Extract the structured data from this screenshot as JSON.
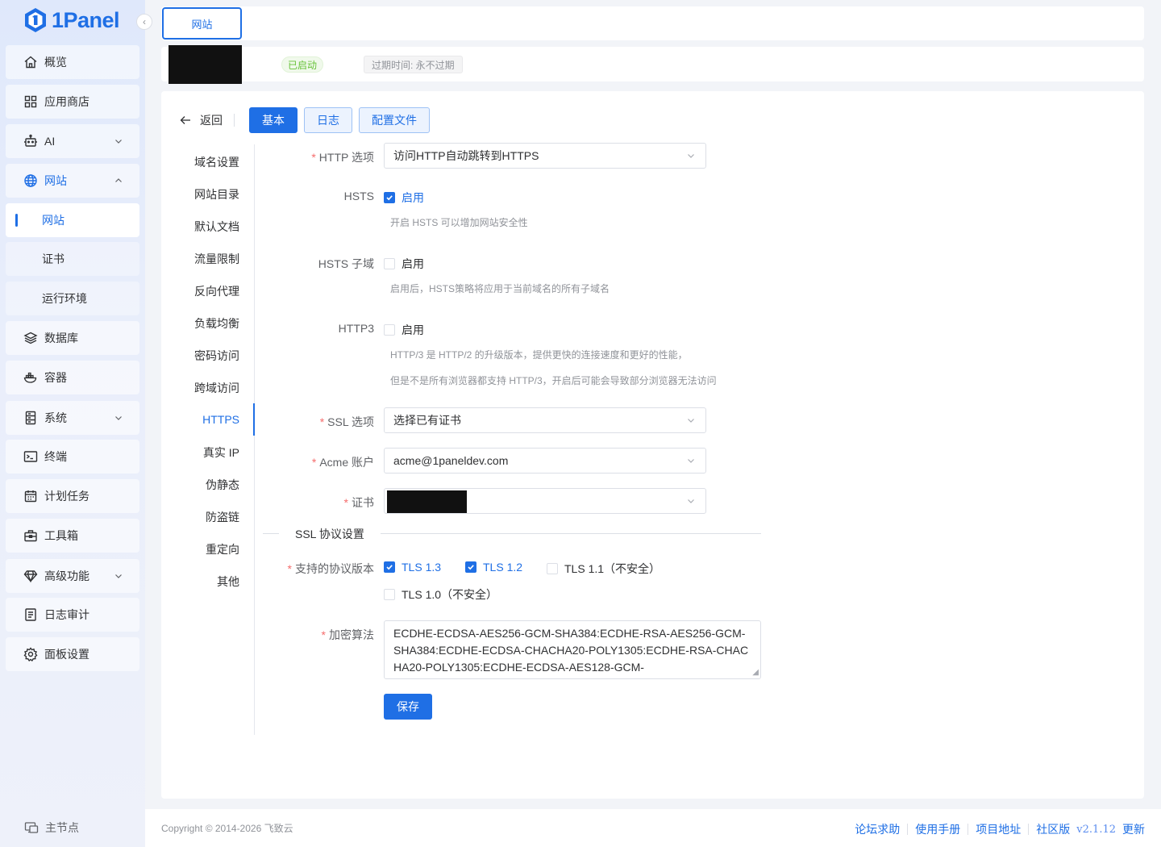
{
  "app": {
    "logo_text": "1Panel",
    "collapse_icon": "chevron-left-icon"
  },
  "sidebar": {
    "items": [
      {
        "label": "概览",
        "icon": "home-icon"
      },
      {
        "label": "应用商店",
        "icon": "grid-icon"
      },
      {
        "label": "AI",
        "icon": "robot-icon"
      },
      {
        "label": "网站",
        "icon": "globe-icon"
      },
      {
        "label": "数据库",
        "icon": "layers-icon"
      },
      {
        "label": "容器",
        "icon": "docker-icon"
      },
      {
        "label": "系统",
        "icon": "server-icon"
      },
      {
        "label": "终端",
        "icon": "terminal-icon"
      },
      {
        "label": "计划任务",
        "icon": "calendar-icon"
      },
      {
        "label": "工具箱",
        "icon": "toolbox-icon"
      },
      {
        "label": "高级功能",
        "icon": "diamond-icon"
      },
      {
        "label": "日志审计",
        "icon": "log-icon"
      },
      {
        "label": "面板设置",
        "icon": "gear-icon"
      }
    ],
    "website_sub": [
      "网站",
      "证书",
      "运行环境"
    ],
    "node_label": "主节点"
  },
  "tabs": {
    "website": "网站"
  },
  "site_info": {
    "status": "已启动",
    "expire": "过期时间: 永不过期"
  },
  "toolbar": {
    "back": "返回",
    "basic": "基本",
    "log": "日志",
    "config": "配置文件"
  },
  "subnav": [
    "域名设置",
    "网站目录",
    "默认文档",
    "流量限制",
    "反向代理",
    "负载均衡",
    "密码访问",
    "跨域访问",
    "HTTPS",
    "真实 IP",
    "伪静态",
    "防盗链",
    "重定向",
    "其他"
  ],
  "form": {
    "http_option": {
      "label": "HTTP 选项",
      "value": "访问HTTP自动跳转到HTTPS"
    },
    "hsts": {
      "label": "HSTS",
      "checkbox": "启用",
      "checked": true,
      "hint": "开启 HSTS 可以增加网站安全性"
    },
    "hsts_sub": {
      "label": "HSTS 子域",
      "checkbox": "启用",
      "checked": false,
      "hint": "启用后，HSTS策略将应用于当前域名的所有子域名"
    },
    "http3": {
      "label": "HTTP3",
      "checkbox": "启用",
      "checked": false,
      "hint1": "HTTP/3 是 HTTP/2 的升级版本，提供更快的连接速度和更好的性能，",
      "hint2": "但是不是所有浏览器都支持 HTTP/3，开启后可能会导致部分浏览器无法访问"
    },
    "ssl_option": {
      "label": "SSL 选项",
      "value": "选择已有证书"
    },
    "acme": {
      "label": "Acme 账户",
      "value": "acme@1paneldev.com"
    },
    "cert": {
      "label": "证书"
    },
    "ssl_section": "SSL 协议设置",
    "protocols": {
      "label": "支持的协议版本",
      "items": [
        {
          "name": "TLS 1.3",
          "checked": true
        },
        {
          "name": "TLS 1.2",
          "checked": true
        },
        {
          "name": "TLS 1.1（不安全）",
          "checked": false
        },
        {
          "name": "TLS 1.0（不安全）",
          "checked": false
        }
      ]
    },
    "cipher": {
      "label": "加密算法",
      "value": "ECDHE-ECDSA-AES256-GCM-SHA384:ECDHE-RSA-AES256-GCM-SHA384:ECDHE-ECDSA-CHACHA20-POLY1305:ECDHE-RSA-CHACHA20-POLY1305:ECDHE-ECDSA-AES128-GCM-"
    },
    "save": "保存"
  },
  "footer": {
    "copyright": "Copyright © 2014-2026 飞致云",
    "links": [
      "论坛求助",
      "使用手册",
      "项目地址",
      "社区版"
    ],
    "version": "v2.1.12",
    "update": "更新"
  },
  "colors": {
    "primary": "#1f6fe5",
    "success": "#67c23a",
    "danger": "#f56c6c"
  }
}
